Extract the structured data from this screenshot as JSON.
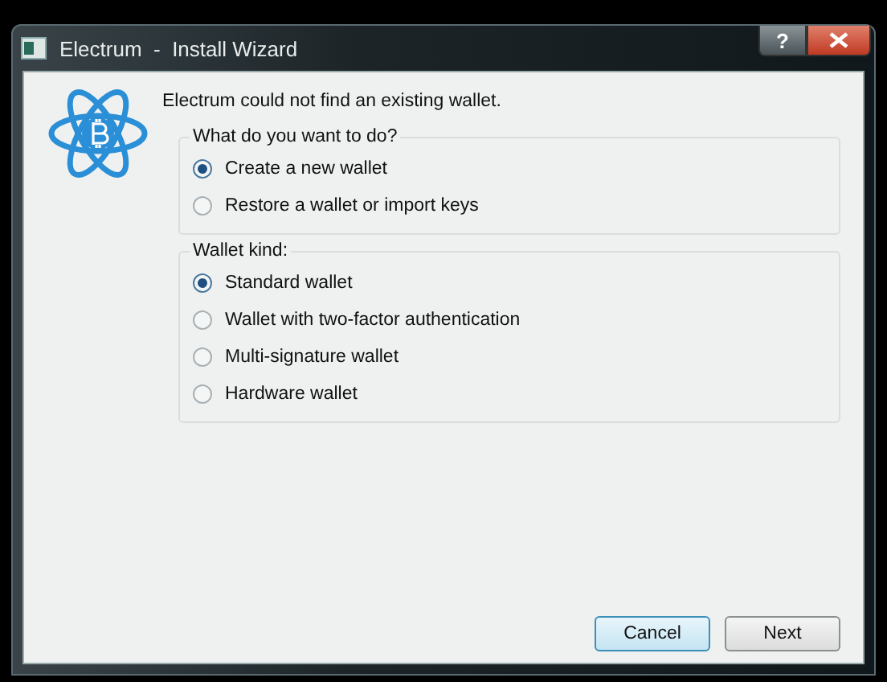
{
  "window": {
    "title": "Electrum  -  Install Wizard",
    "help_button": "?"
  },
  "message": "Electrum could not find an existing wallet.",
  "groups": [
    {
      "title": "What do you want to do?",
      "options": [
        {
          "label": "Create a new wallet",
          "selected": true
        },
        {
          "label": "Restore a wallet or import keys",
          "selected": false
        }
      ]
    },
    {
      "title": "Wallet kind:",
      "options": [
        {
          "label": "Standard wallet",
          "selected": true
        },
        {
          "label": "Wallet with two-factor authentication",
          "selected": false
        },
        {
          "label": "Multi-signature wallet",
          "selected": false
        },
        {
          "label": "Hardware wallet",
          "selected": false
        }
      ]
    }
  ],
  "buttons": [
    {
      "label": "Cancel",
      "focused": true
    },
    {
      "label": "Next",
      "focused": false
    }
  ]
}
